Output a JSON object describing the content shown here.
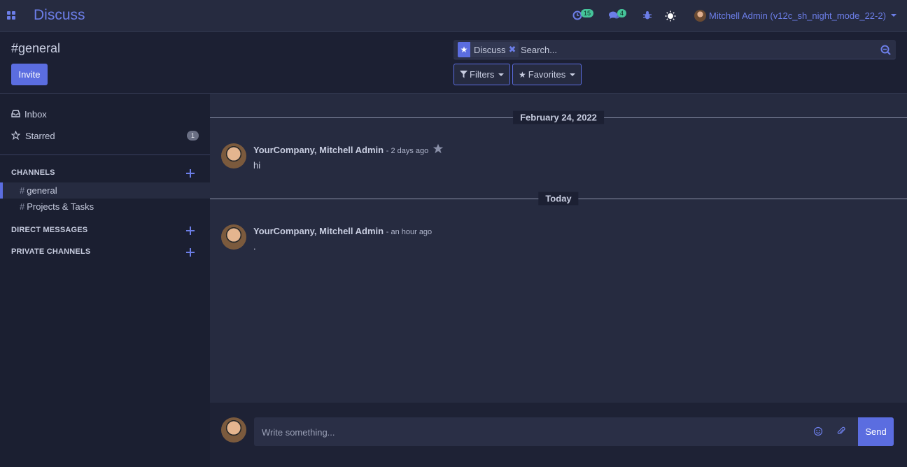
{
  "navbar": {
    "app_name": "Discuss",
    "activity_count": "15",
    "messages_count": "4",
    "user_name": "Mitchell Admin (v12c_sh_night_mode_22-2)"
  },
  "control_panel": {
    "title": "#general",
    "invite_label": "Invite",
    "facet_label": "Discuss",
    "search_placeholder": "Search...",
    "filters_label": "Filters",
    "favorites_label": "Favorites"
  },
  "sidebar": {
    "inbox_label": "Inbox",
    "starred_label": "Starred",
    "starred_count": "1",
    "channels_header": "CHANNELS",
    "channels": [
      {
        "name": "general",
        "hash": "#"
      },
      {
        "name": "Projects & Tasks",
        "hash": "#"
      }
    ],
    "direct_messages_header": "DIRECT MESSAGES",
    "private_channels_header": "PRIVATE CHANNELS"
  },
  "thread": {
    "groups": [
      {
        "date_label": "February 24, 2022",
        "author": "YourCompany, Mitchell Admin",
        "time": "- 2 days ago",
        "body": "hi"
      },
      {
        "date_label": "Today",
        "author": "YourCompany, Mitchell Admin",
        "time": "- an hour ago",
        "body": "."
      }
    ]
  },
  "composer": {
    "placeholder": "Write something...",
    "send_label": "Send"
  },
  "colors": {
    "accent": "#5b6de0",
    "badge_green": "#45c49a"
  }
}
